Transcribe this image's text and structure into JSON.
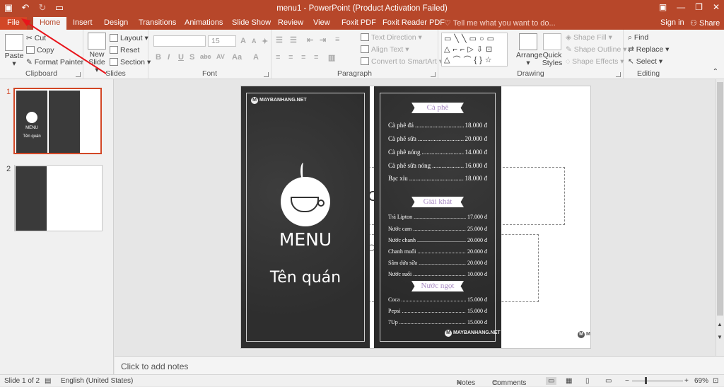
{
  "window": {
    "title": "menu1 - PowerPoint (Product Activation Failed)"
  },
  "tabs": [
    "File",
    "Home",
    "Insert",
    "Design",
    "Transitions",
    "Animations",
    "Slide Show",
    "Review",
    "View",
    "Foxit PDF",
    "Foxit Reader PDF"
  ],
  "tellme": "Tell me what you want to do...",
  "account": {
    "signin": "Sign in",
    "share": "Share"
  },
  "ribbon": {
    "clipboard": {
      "label": "Clipboard",
      "paste": "Paste",
      "cut": "Cut",
      "copy": "Copy",
      "format_painter": "Format Painter"
    },
    "slides": {
      "label": "Slides",
      "new_slide": "New Slide",
      "layout": "Layout",
      "reset": "Reset",
      "section": "Section"
    },
    "font": {
      "label": "Font",
      "size": "15"
    },
    "paragraph": {
      "label": "Paragraph",
      "text_direction": "Text Direction",
      "align_text": "Align Text",
      "convert_smartart": "Convert to SmartArt"
    },
    "drawing": {
      "label": "Drawing",
      "arrange": "Arrange",
      "quick_styles": "Quick Styles",
      "shape_fill": "Shape Fill",
      "shape_outline": "Shape Outline",
      "shape_effects": "Shape Effects"
    },
    "editing": {
      "label": "Editing",
      "find": "Find",
      "replace": "Replace",
      "select": "Select"
    }
  },
  "slides_panel": [
    {
      "num": "1",
      "menu": "MENU",
      "shop": "Tên quán"
    },
    {
      "num": "2"
    }
  ],
  "slide": {
    "brand": "MAYBANHANG.NET",
    "brand_letter": "M",
    "menu_title": "MENU",
    "shop_name": "Tên quán",
    "placeholder_char": "C",
    "sections": [
      {
        "title": "Cà phê",
        "items": [
          {
            "name": "Cà phê đá",
            "price": "18.000 đ"
          },
          {
            "name": "Cà phê sữa",
            "price": "20.000 đ"
          },
          {
            "name": "Cà phê nóng",
            "price": "14.000 đ"
          },
          {
            "name": "Cà phê sữa nóng",
            "price": "16.000 đ"
          },
          {
            "name": "Bạc xỉu",
            "price": "18.000 đ"
          }
        ]
      },
      {
        "title": "Giải khát",
        "items": [
          {
            "name": "Trà Lipton",
            "price": "17.000 đ"
          },
          {
            "name": "Nước cam",
            "price": "25.000 đ"
          },
          {
            "name": "Nước chanh",
            "price": "20.000 đ"
          },
          {
            "name": "Chanh muối",
            "price": "20.000 đ"
          },
          {
            "name": "Sâm dứa sữa",
            "price": "20.000 đ"
          },
          {
            "name": "Nước suối",
            "price": "10.000 đ"
          }
        ]
      },
      {
        "title": "Nước ngọt",
        "items": [
          {
            "name": "Coca",
            "price": "15.000 đ"
          },
          {
            "name": "Pepsi",
            "price": "15.000 đ"
          },
          {
            "name": "7Up",
            "price": "15.000 đ"
          }
        ]
      }
    ]
  },
  "notes_placeholder": "Click to add notes",
  "status": {
    "slide": "Slide 1 of 2",
    "language": "English (United States)",
    "notes": "Notes",
    "comments": "Comments",
    "zoom": "69%"
  },
  "colors": {
    "accent": "#b7472a",
    "file_tab": "#d24726",
    "annotation_arrow": "#e8151b"
  }
}
